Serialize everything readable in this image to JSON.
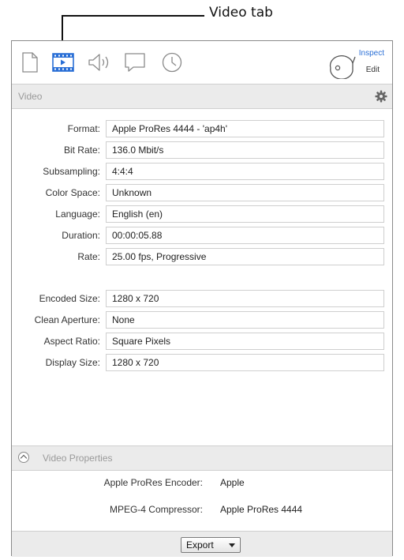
{
  "callout": {
    "label": "Video tab"
  },
  "toolbar": {
    "tabs": [
      {
        "name": "file-tab",
        "icon": "document-icon",
        "selected": false
      },
      {
        "name": "video-tab",
        "icon": "film-icon",
        "selected": true
      },
      {
        "name": "audio-tab",
        "icon": "speaker-icon",
        "selected": false
      },
      {
        "name": "captions-tab",
        "icon": "speech-bubble-icon",
        "selected": false
      },
      {
        "name": "timecode-tab",
        "icon": "clock-icon",
        "selected": false
      }
    ],
    "mode": {
      "inspect_label": "Inspect",
      "edit_label": "Edit",
      "active": "Inspect"
    }
  },
  "section": {
    "title": "Video"
  },
  "fields": [
    {
      "label": "Format:",
      "value": "Apple ProRes 4444 - 'ap4h'"
    },
    {
      "label": "Bit Rate:",
      "value": "136.0 Mbit/s"
    },
    {
      "label": "Subsampling:",
      "value": "4:4:4"
    },
    {
      "label": "Color Space:",
      "value": "Unknown"
    },
    {
      "label": "Language:",
      "value": "English (en)"
    },
    {
      "label": "Duration:",
      "value": "00:00:05.88"
    },
    {
      "label": "Rate:",
      "value": "25.00 fps, Progressive"
    },
    {
      "label": "Encoded Size:",
      "value": "1280 x 720"
    },
    {
      "label": "Clean Aperture:",
      "value": "None"
    },
    {
      "label": "Aspect Ratio:",
      "value": "Square Pixels"
    },
    {
      "label": "Display Size:",
      "value": "1280 x 720"
    }
  ],
  "properties": {
    "title": "Video Properties",
    "items": [
      {
        "label": "Apple ProRes Encoder:",
        "value": "Apple"
      },
      {
        "label": "MPEG-4 Compressor:",
        "value": "Apple ProRes 4444"
      }
    ]
  },
  "footer": {
    "export_label": "Export"
  },
  "colors": {
    "accent": "#2a6fd6",
    "header_bg": "#ebebeb",
    "border": "#cfcfcf"
  }
}
